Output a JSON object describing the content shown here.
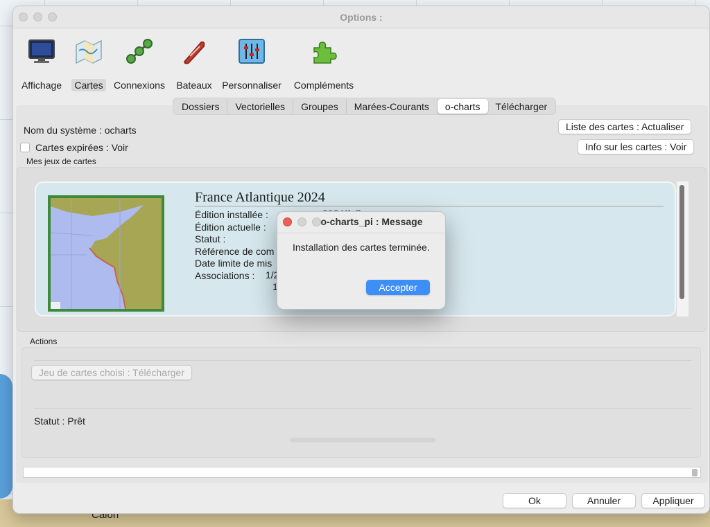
{
  "window": {
    "title": "Options :"
  },
  "toolbar": {
    "items": [
      {
        "label": "Affichage",
        "icon": "monitor-icon"
      },
      {
        "label": "Cartes",
        "icon": "charts-icon",
        "active": true
      },
      {
        "label": "Connexions",
        "icon": "connections-icon"
      },
      {
        "label": "Bateaux",
        "icon": "boat-icon"
      },
      {
        "label": "Personnaliser",
        "icon": "sliders-icon"
      },
      {
        "label": "Compléments",
        "icon": "puzzle-icon"
      }
    ]
  },
  "tabs": [
    {
      "label": "Dossiers"
    },
    {
      "label": "Vectorielles"
    },
    {
      "label": "Groupes"
    },
    {
      "label": "Marées-Courants"
    },
    {
      "label": "o-charts",
      "active": true
    },
    {
      "label": "Télécharger"
    }
  ],
  "system": {
    "name": "Nom du système : ocharts",
    "expired_label": "Cartes expirées : Voir",
    "list_button": "Liste des cartes : Actualiser",
    "info_button": "Info sur les cartes : Voir"
  },
  "sets": {
    "section_label": "Mes jeux de cartes",
    "chart": {
      "title": "France Atlantique 2024",
      "lines": [
        "Édition installée :",
        "Édition actuelle :",
        "Statut :",
        "Référence de com",
        "Date limite de mis",
        "Associations :"
      ],
      "partial_values": {
        "assoc_1": "1/2",
        "assoc_2": "1",
        "edition": "2024/1-7"
      }
    }
  },
  "actions": {
    "section_label": "Actions",
    "download_button": "Jeu de cartes choisi : Télécharger",
    "status": "Statut : Prêt"
  },
  "footer": {
    "ok": "Ok",
    "cancel": "Annuler",
    "apply": "Appliquer"
  },
  "dialog": {
    "title": "o-charts_pi : Message",
    "message": "Installation des cartes terminée.",
    "accept": "Accepter"
  },
  "background": {
    "label": "Calon"
  },
  "colors": {
    "accent": "#3d8ef6",
    "thumb_border": "#3e8a3a",
    "card": "#d6e8ee"
  }
}
